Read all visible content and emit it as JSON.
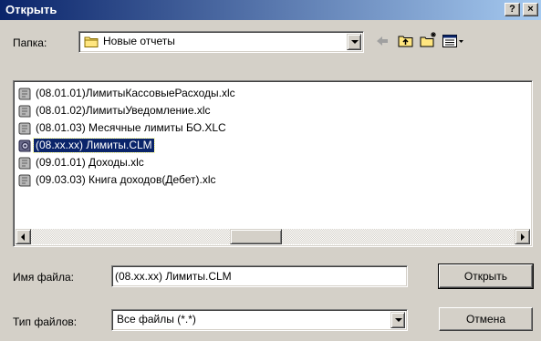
{
  "window": {
    "title": "Открыть",
    "help_label": "?",
    "close_label": "×"
  },
  "folder": {
    "label": "Папка:",
    "value": "Новые отчеты"
  },
  "files": [
    {
      "name": "(08.01.01)ЛимитыКассовыеРасходы.xlc",
      "icon": "script-scroll-icon",
      "selected": false
    },
    {
      "name": "(08.01.02)ЛимитыУведомление.xlc",
      "icon": "script-scroll-icon",
      "selected": false
    },
    {
      "name": "(08.01.03) Месячные лимиты БО.XLC",
      "icon": "script-scroll-icon",
      "selected": false
    },
    {
      "name": "(08.xx.xx) Лимиты.CLM",
      "icon": "gear-scroll-icon",
      "selected": true
    },
    {
      "name": "(09.01.01) Доходы.xlc",
      "icon": "script-scroll-icon",
      "selected": false
    },
    {
      "name": "(09.03.03) Книга доходов(Дебет).xlc",
      "icon": "script-scroll-icon",
      "selected": false
    }
  ],
  "filename": {
    "label": "Имя файла:",
    "value": "(08.xx.xx) Лимиты.CLM"
  },
  "filetype": {
    "label": "Тип файлов:",
    "value": "Все файлы (*.*)"
  },
  "buttons": {
    "open": "Открыть",
    "cancel": "Отмена"
  },
  "colors": {
    "titlebar_start": "#0a246a",
    "titlebar_end": "#a6caf0",
    "selection": "#0a246a",
    "face": "#d4d0c8"
  }
}
